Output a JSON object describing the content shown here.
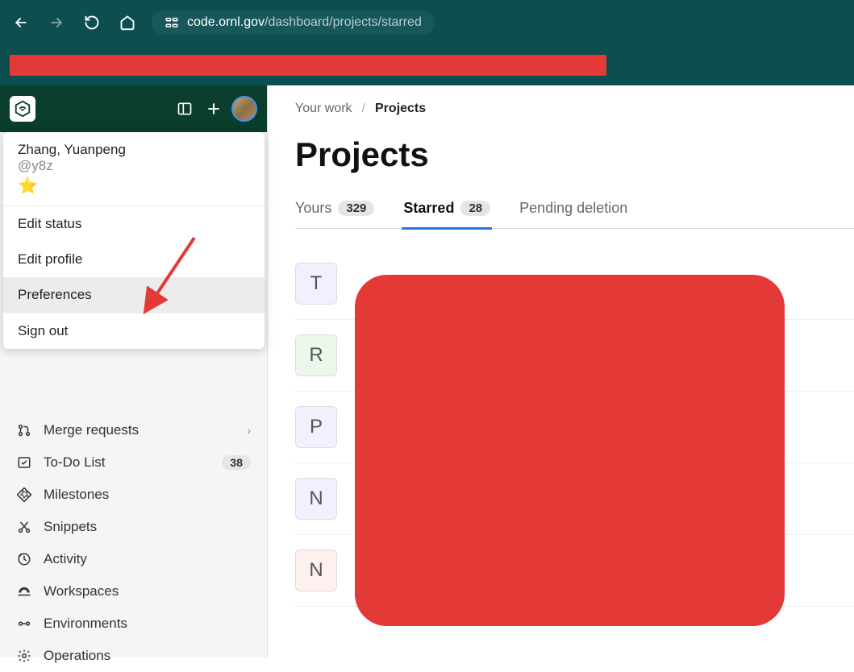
{
  "browser": {
    "url_host": "code.ornl.gov",
    "url_path": "/dashboard/projects/starred"
  },
  "user_menu": {
    "name": "Zhang, Yuanpeng",
    "handle": "@y8z",
    "star": "⭐",
    "items": {
      "edit_status": "Edit status",
      "edit_profile": "Edit profile",
      "preferences": "Preferences",
      "sign_out": "Sign out"
    }
  },
  "sidebar_nav": {
    "merge_requests": "Merge requests",
    "todo": "To-Do List",
    "todo_count": "38",
    "milestones": "Milestones",
    "snippets": "Snippets",
    "activity": "Activity",
    "workspaces": "Workspaces",
    "environments": "Environments",
    "operations": "Operations"
  },
  "breadcrumb": {
    "your_work": "Your work",
    "projects": "Projects"
  },
  "page_title": "Projects",
  "tabs": {
    "yours_label": "Yours",
    "yours_count": "329",
    "starred_label": "Starred",
    "starred_count": "28",
    "pending_label": "Pending deletion"
  },
  "projects": [
    {
      "letter": "T",
      "cls": "pa-t"
    },
    {
      "letter": "R",
      "cls": "pa-r"
    },
    {
      "letter": "P",
      "cls": "pa-p"
    },
    {
      "letter": "N",
      "cls": "pa-n1"
    },
    {
      "letter": "N",
      "cls": "pa-n2"
    }
  ]
}
